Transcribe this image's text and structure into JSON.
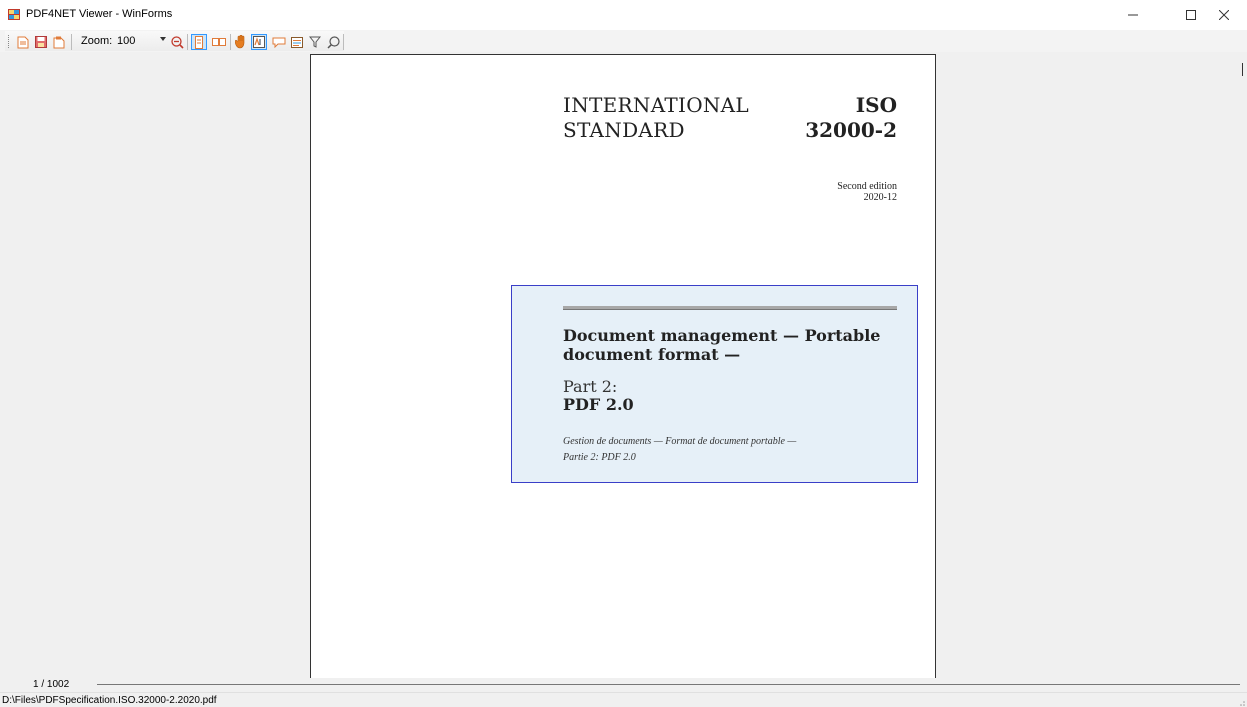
{
  "window": {
    "title": "PDF4NET Viewer - WinForms",
    "controls": [
      "minimize-icon",
      "maximize-icon",
      "close-icon"
    ]
  },
  "toolbar": {
    "icons": [
      "open-file-icon",
      "save-icon",
      "open-folder-icon",
      "zoom-out-icon",
      "single-page-icon",
      "continuous-pages-icon",
      "pan-hand-icon",
      "text-select-icon",
      "comment-icon",
      "form-icon",
      "filter-icon",
      "search-icon"
    ],
    "zoom_label": "Zoom:",
    "zoom_value": "100"
  },
  "document": {
    "title_left_line1": "INTERNATIONAL",
    "title_left_line2": "STANDARD",
    "title_right_line1": "ISO",
    "title_right_line2": "32000-2",
    "edition_line1": "Second edition",
    "edition_line2": "2020-12",
    "main_title_line1": "Document management — Portable",
    "main_title_line2": "document format —",
    "part_label": "Part 2:",
    "part_title": "PDF 2.0",
    "french_line1": "Gestion de documents — Format de document portable —",
    "french_line2": "Partie 2: PDF 2.0"
  },
  "navigation": {
    "page_counter": "1 / 1002"
  },
  "status": {
    "file_path": "D:\\Files\\PDFSpecification.ISO.32000-2.2020.pdf"
  },
  "colors": {
    "accent": "#3399ff",
    "title_box_fill": "#e6f0f8",
    "title_box_border": "#3a3fc8"
  }
}
